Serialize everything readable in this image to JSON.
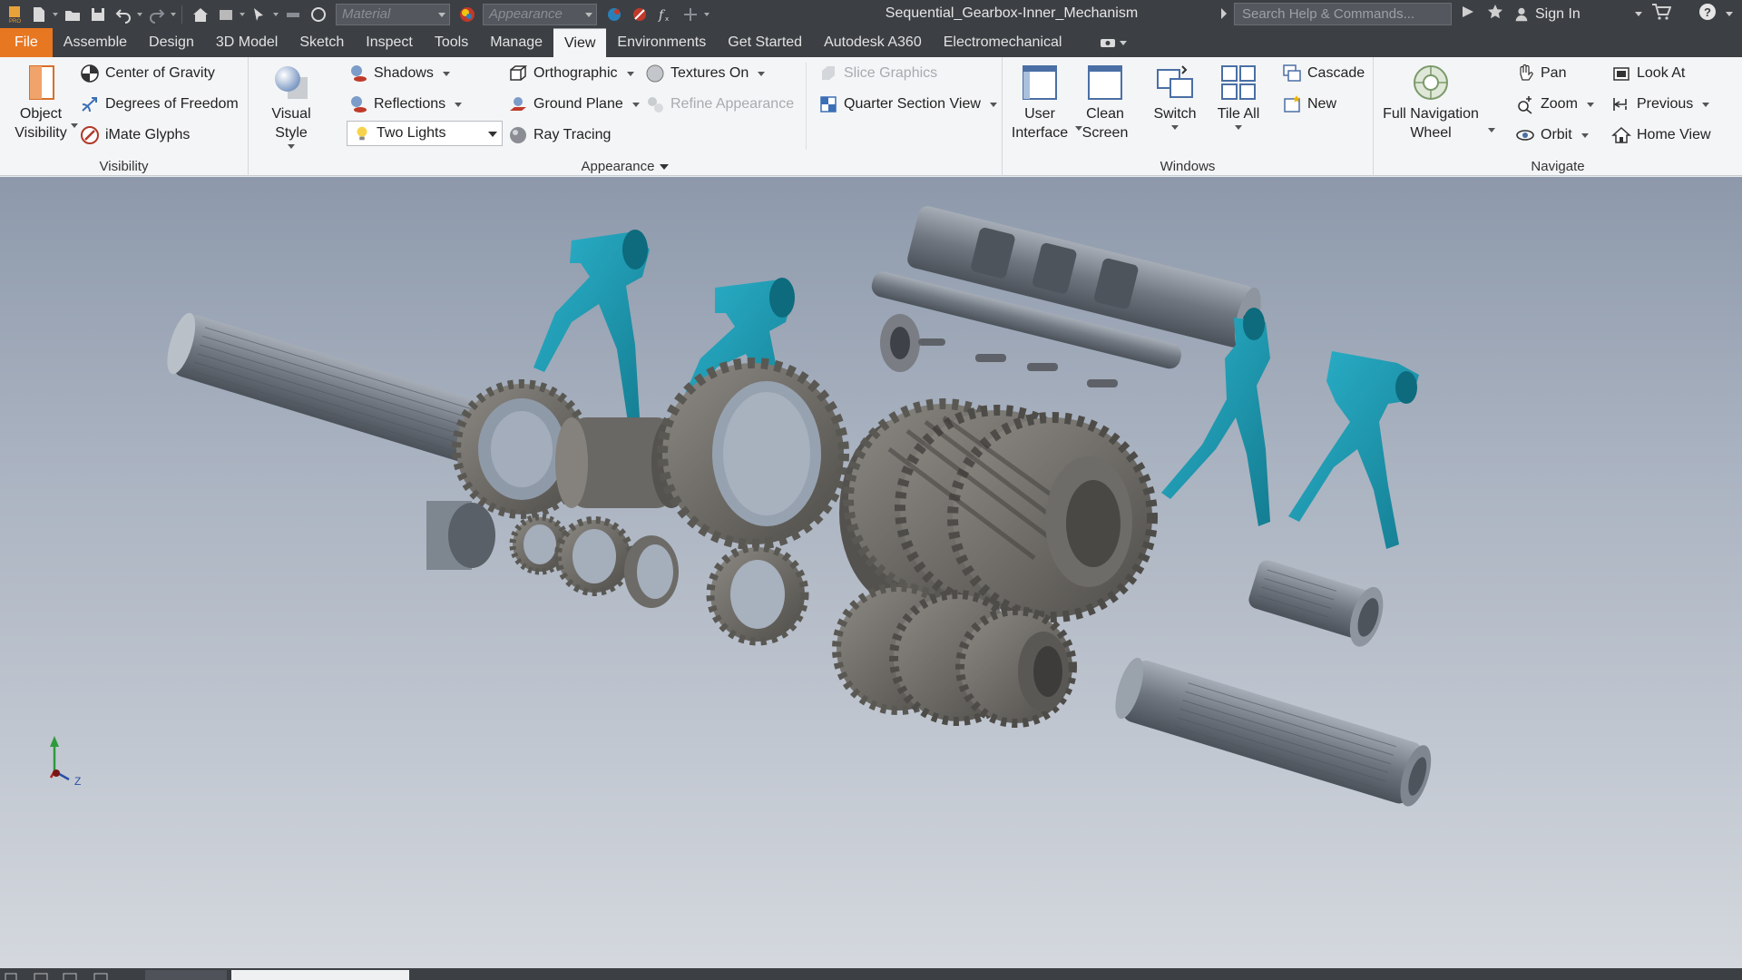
{
  "window": {
    "title": "Sequential_Gearbox-Inner_Mechanism",
    "material_placeholder": "Material",
    "appearance_placeholder": "Appearance",
    "search_placeholder": "Search Help & Commands...",
    "sign_in": "Sign In"
  },
  "tabs": [
    {
      "label": "File"
    },
    {
      "label": "Assemble"
    },
    {
      "label": "Design"
    },
    {
      "label": "3D Model"
    },
    {
      "label": "Sketch"
    },
    {
      "label": "Inspect"
    },
    {
      "label": "Tools"
    },
    {
      "label": "Manage"
    },
    {
      "label": "View"
    },
    {
      "label": "Environments"
    },
    {
      "label": "Get Started"
    },
    {
      "label": "Autodesk A360"
    },
    {
      "label": "Electromechanical"
    }
  ],
  "ribbon": {
    "visibility": {
      "title": "Visibility",
      "object_visibility_line1": "Object",
      "object_visibility_line2": "Visibility",
      "center_of_gravity": "Center of Gravity",
      "degrees_of_freedom": "Degrees of Freedom",
      "imate_glyphs": "iMate Glyphs"
    },
    "appearance": {
      "title": "Appearance",
      "visual_style": "Visual Style",
      "shadows": "Shadows",
      "reflections": "Reflections",
      "lighting": "Two Lights",
      "orthographic": "Orthographic",
      "ground_plane": "Ground Plane",
      "ray_tracing": "Ray Tracing",
      "textures_on": "Textures On",
      "refine_appearance": "Refine Appearance",
      "slice_graphics": "Slice Graphics",
      "quarter_section_view": "Quarter Section View"
    },
    "windows": {
      "title": "Windows",
      "user_interface_line1": "User",
      "user_interface_line2": "Interface",
      "clean_screen_line1": "Clean",
      "clean_screen_line2": "Screen",
      "switch": "Switch",
      "tile_all": "Tile All",
      "cascade": "Cascade",
      "new": "New"
    },
    "navigate": {
      "title": "Navigate",
      "full_nav_line1": "Full Navigation",
      "full_nav_line2": "Wheel",
      "pan": "Pan",
      "zoom": "Zoom",
      "orbit": "Orbit",
      "look_at": "Look At",
      "previous": "Previous",
      "home_view": "Home View"
    }
  },
  "viewport": {
    "triad_z_label": "Z",
    "colors": {
      "fork": "#1a9cb3",
      "gear": "#6e6c68",
      "shaft": "#7f868f"
    }
  }
}
